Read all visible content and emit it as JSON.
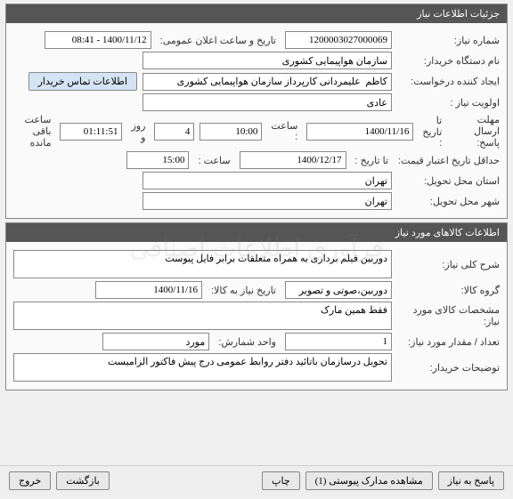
{
  "panel1": {
    "title": "جزئیات اطلاعات نیاز",
    "need_no_label": "شماره نیاز:",
    "need_no": "1200003027000069",
    "announce_label": "تاریخ و ساعت اعلان عمومی:",
    "announce_val": "1400/11/12 - 08:41",
    "buyer_label": "نام دستگاه خریدار:",
    "buyer_val": "سازمان هواپیمایی کشوری",
    "creator_label": "ایجاد کننده درخواست:",
    "creator_val": "کاظم  علیمردانی کارپرداز سازمان هواپیمایی کشوری",
    "contact_btn": "اطلاعات تماس خریدار",
    "priority_label": "اولویت نیاز :",
    "priority_val": "عادی",
    "deadline_label": "مهلت ارسال پاسخ:",
    "to_date_label": "تا تاریخ :",
    "deadline_date": "1400/11/16",
    "time_label": "ساعت :",
    "deadline_time": "10:00",
    "remain_days": "4",
    "remain_days_label": "روز و",
    "remain_time": "01:11:51",
    "remain_time_label": "ساعت باقی مانده",
    "valid_label": "حداقل تاریخ اعتبار قیمت:",
    "valid_date": "1400/12/17",
    "valid_time": "15:00",
    "province_label": "استان محل تحویل:",
    "province_val": "تهران",
    "city_label": "شهر محل تحویل:",
    "city_val": "تهران"
  },
  "panel2": {
    "title": "اطلاعات کالاهای مورد نیاز",
    "desc_label": "شرح کلی نیاز:",
    "desc_val": "دوربین فیلم برداری به همراه متعلقات برابر فایل پیوست",
    "group_label": "گروه کالا:",
    "group_val": "دوربین،صوتی و تصویر",
    "need_date_label": "تاریخ نیاز به کالا:",
    "need_date_val": "1400/11/16",
    "spec_label": "مشخصات کالای مورد نیاز:",
    "spec_val": "فقط همین مارک",
    "qty_label": "تعداد / مقدار مورد نیاز:",
    "qty_val": "1",
    "unit_label": "واحد شمارش:",
    "unit_val": "مورد",
    "notes_label": "توضیحات خریدار:",
    "notes_val": "تحویل درسازمان باتائید دفتر روابط عمومی درج پیش فاکتور الزامیست"
  },
  "footer": {
    "respond": "پاسخ به نیاز",
    "attach": "مشاهده مدارک پیوستی (1)",
    "print": "چاپ",
    "back": "بازگشت",
    "exit": "خروج"
  }
}
